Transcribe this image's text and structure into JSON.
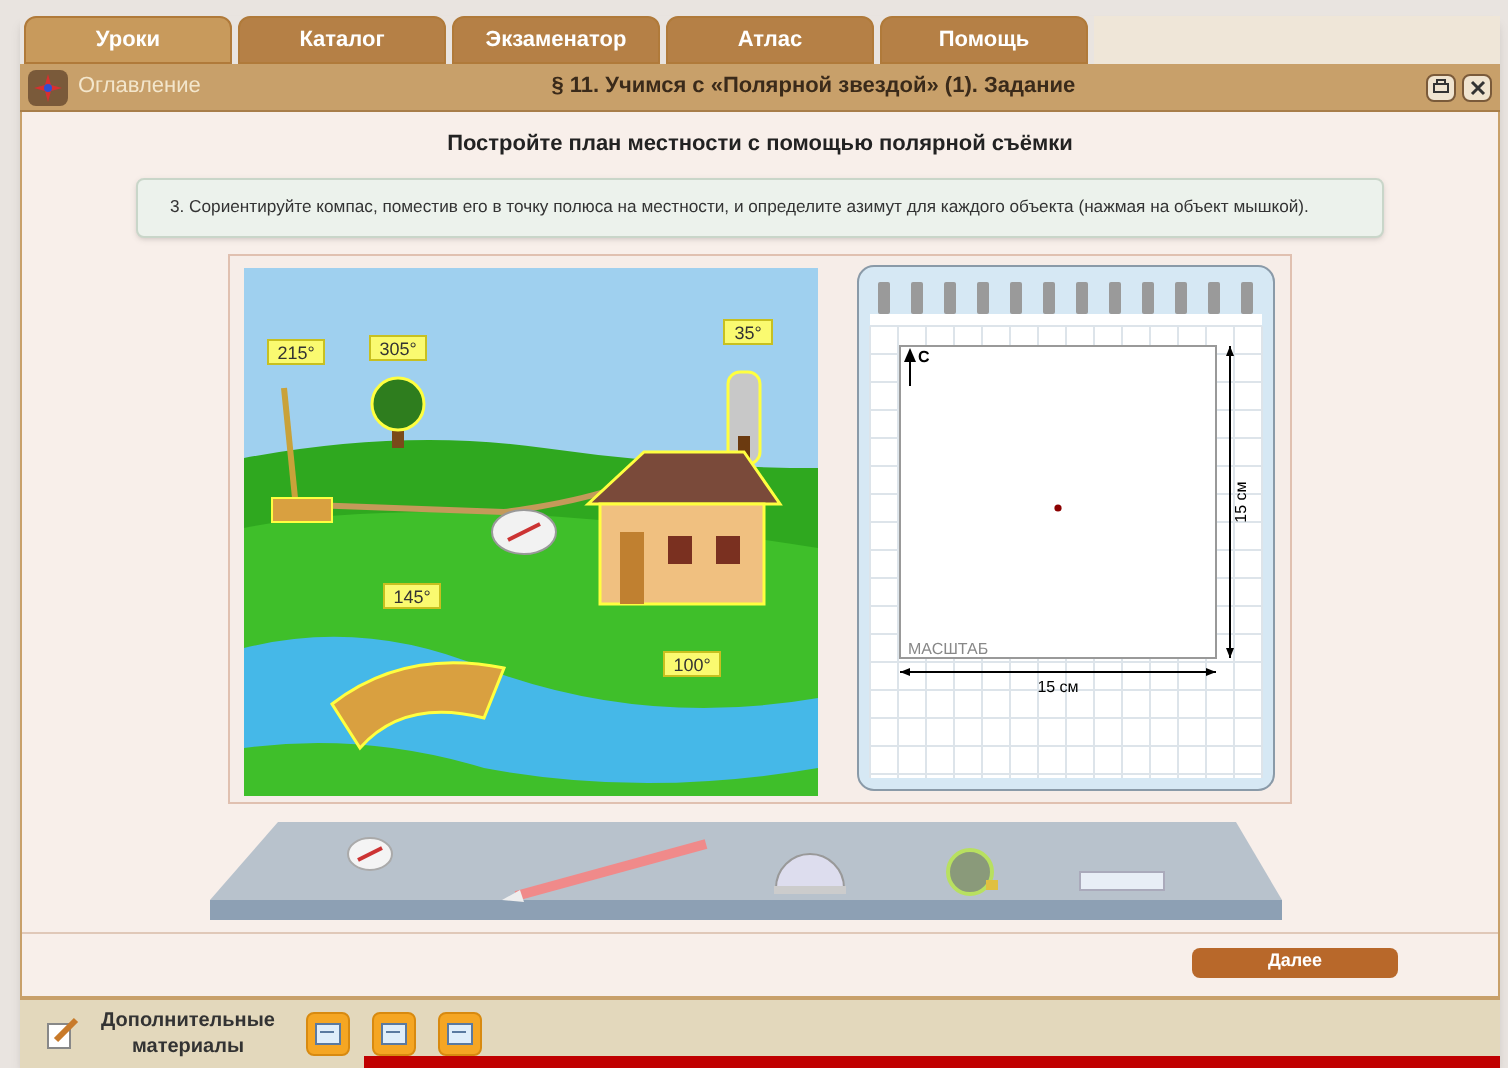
{
  "tabs": [
    {
      "label": "Уроки",
      "selected": true
    },
    {
      "label": "Каталог",
      "selected": false
    },
    {
      "label": "Экзаменатор",
      "selected": false
    },
    {
      "label": "Атлас",
      "selected": false
    },
    {
      "label": "Помощь",
      "selected": false
    }
  ],
  "header": {
    "toc_link": "Оглавление",
    "title": "§ 11. Учимся с «Полярной звездой» (1). Задание"
  },
  "heading": "Постройте план местности с помощью полярной съёмки",
  "instruction": "3. Сориентируйте компас, поместив его в точку полюса на местности, и определите азимут для каждого объекта (нажмая на объект мышкой).",
  "scene_labels": [
    {
      "kind": "well",
      "text": "215°"
    },
    {
      "kind": "tree",
      "text": "305°"
    },
    {
      "kind": "silo",
      "text": "35°"
    },
    {
      "kind": "bridge",
      "text": "145°"
    },
    {
      "kind": "house",
      "text": "100°"
    }
  ],
  "notebook": {
    "north": "С",
    "scale_label": "МАСШТАБ",
    "width": "15 см",
    "height": "15 см"
  },
  "next_button": "Далее",
  "footer": {
    "materials_label": "Дополнительные материалы"
  }
}
